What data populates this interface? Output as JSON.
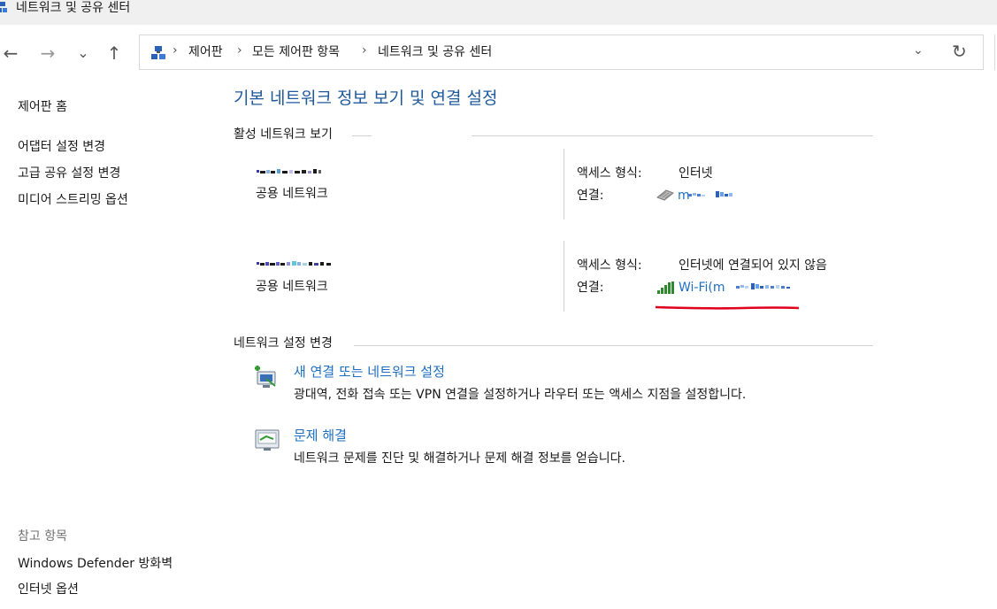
{
  "window": {
    "title": "네트워크 및 공유 센터"
  },
  "nav": {
    "back": "←",
    "forward": "→",
    "recent": "⌄",
    "up": "↑"
  },
  "address": {
    "crumbs": [
      "제어판",
      "모든 제어판 항목",
      "네트워크 및 공유 센터"
    ],
    "separator": "›",
    "dropdown": "⌄",
    "refresh": "↻"
  },
  "sidebar": {
    "home": "제어판 홈",
    "links": [
      "어댑터 설정 변경",
      "고급 공유 설정 변경",
      "미디어 스트리밍 옵션"
    ],
    "see_also_title": "참고 항목",
    "see_also": [
      "Windows Defender 방화벽",
      "인터넷 옵션"
    ]
  },
  "main": {
    "title": "기본 네트워크 정보 보기 및 연결 설정",
    "active_section": "활성 네트워크 보기",
    "networks": [
      {
        "type": "공용 네트워크",
        "access_label": "액세스 형식:",
        "access_value": "인터넷",
        "conn_label": "연결:",
        "conn_value": "m"
      },
      {
        "type": "공용 네트워크",
        "access_label": "액세스 형식:",
        "access_value": "인터넷에 연결되어 있지 않음",
        "conn_label": "연결:",
        "conn_value": "Wi-Fi(m"
      }
    ],
    "change_section": "네트워크 설정 변경",
    "tasks": [
      {
        "title": "새 연결 또는 네트워크 설정",
        "desc": "광대역, 전화 접속 또는 VPN 연결을 설정하거나 라우터 또는 액세스 지점을 설정합니다."
      },
      {
        "title": "문제 해결",
        "desc": "네트워크 문제를 진단 및 해결하거나 문제 해결 정보를 얻습니다."
      }
    ]
  },
  "colors": {
    "link": "#1e6fc0",
    "heading": "#1e5a9c",
    "annotation": "#e0001b"
  }
}
